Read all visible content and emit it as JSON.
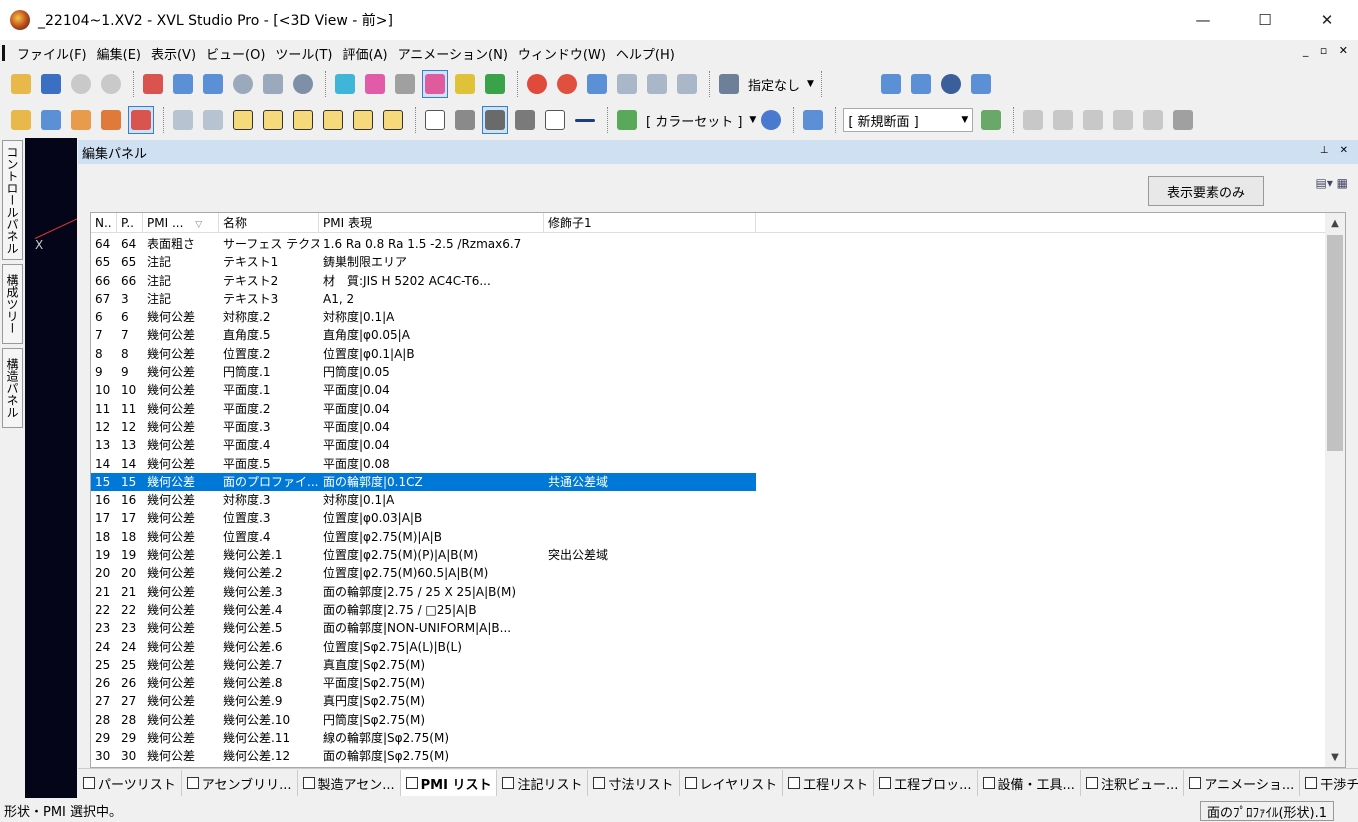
{
  "window": {
    "title": "_22104~1.XV2 - XVL Studio Pro - [<3D View - 前>]",
    "minimize": "—",
    "maximize": "☐",
    "close": "✕"
  },
  "menu": [
    {
      "label": "ファイル(F)"
    },
    {
      "label": "編集(E)"
    },
    {
      "label": "表示(V)"
    },
    {
      "label": "ビュー(O)"
    },
    {
      "label": "ツール(T)"
    },
    {
      "label": "評価(A)"
    },
    {
      "label": "アニメーション(N)"
    },
    {
      "label": "ウィンドウ(W)"
    },
    {
      "label": "ヘルプ(H)"
    }
  ],
  "mdi_controls": "_ ▫ ✕",
  "toolbar": {
    "display_mode": "指定なし",
    "color_set": "[ カラーセット ]",
    "section": "[ 新規断面 ]"
  },
  "left_tabs": [
    {
      "label": "コントロールパネル"
    },
    {
      "label": "構成ツリー"
    },
    {
      "label": "構造パネル"
    }
  ],
  "view3d": {
    "axis_label": "X"
  },
  "panel": {
    "title": "編集パネル",
    "pin": "⊥ ✕",
    "show_only_button": "表示要素のみ"
  },
  "list": {
    "columns": [
      "N..",
      "P..",
      "PMI ...",
      "名称",
      "PMI 表現",
      "修飾子1"
    ],
    "sort_indicator": "▽",
    "rows": [
      {
        "n": "64",
        "p": "64",
        "type": "表面粗さ",
        "name": "サーフェス テクス...",
        "expr": "1.6 Ra 0.8 Ra 1.5 -2.5 /Rzmax6.7",
        "mod": ""
      },
      {
        "n": "65",
        "p": "65",
        "type": "注記",
        "name": "テキスト1",
        "expr": "鋳巣制限エリア",
        "mod": ""
      },
      {
        "n": "66",
        "p": "66",
        "type": "注記",
        "name": "テキスト2",
        "expr": "材　質:JIS H 5202 AC4C-T6...",
        "mod": ""
      },
      {
        "n": "67",
        "p": "3",
        "type": "注記",
        "name": "テキスト3",
        "expr": " A1, 2",
        "mod": ""
      },
      {
        "n": "6",
        "p": "6",
        "type": "幾何公差",
        "name": "対称度.2",
        "expr": "対称度|0.1|A",
        "mod": ""
      },
      {
        "n": "7",
        "p": "7",
        "type": "幾何公差",
        "name": "直角度.5",
        "expr": "直角度|φ0.05|A",
        "mod": ""
      },
      {
        "n": "8",
        "p": "8",
        "type": "幾何公差",
        "name": "位置度.2",
        "expr": "位置度|φ0.1|A|B",
        "mod": ""
      },
      {
        "n": "9",
        "p": "9",
        "type": "幾何公差",
        "name": "円筒度.1",
        "expr": "円筒度|0.05",
        "mod": ""
      },
      {
        "n": "10",
        "p": "10",
        "type": "幾何公差",
        "name": "平面度.1",
        "expr": "平面度|0.04",
        "mod": ""
      },
      {
        "n": "11",
        "p": "11",
        "type": "幾何公差",
        "name": "平面度.2",
        "expr": "平面度|0.04",
        "mod": ""
      },
      {
        "n": "12",
        "p": "12",
        "type": "幾何公差",
        "name": "平面度.3",
        "expr": "平面度|0.04",
        "mod": ""
      },
      {
        "n": "13",
        "p": "13",
        "type": "幾何公差",
        "name": "平面度.4",
        "expr": "平面度|0.04",
        "mod": ""
      },
      {
        "n": "14",
        "p": "14",
        "type": "幾何公差",
        "name": "平面度.5",
        "expr": "平面度|0.08",
        "mod": ""
      },
      {
        "n": "15",
        "p": "15",
        "type": "幾何公差",
        "name": "面のプロファイ...",
        "expr": "面の輪郭度|0.1CZ",
        "mod": "共通公差域",
        "selected": true
      },
      {
        "n": "16",
        "p": "16",
        "type": "幾何公差",
        "name": "対称度.3",
        "expr": "対称度|0.1|A",
        "mod": ""
      },
      {
        "n": "17",
        "p": "17",
        "type": "幾何公差",
        "name": "位置度.3",
        "expr": "位置度|φ0.03|A|B",
        "mod": ""
      },
      {
        "n": "18",
        "p": "18",
        "type": "幾何公差",
        "name": "位置度.4",
        "expr": "位置度|φ2.75(M)|A|B",
        "mod": ""
      },
      {
        "n": "19",
        "p": "19",
        "type": "幾何公差",
        "name": "幾何公差.1",
        "expr": "位置度|φ2.75(M)(P)|A|B(M)",
        "mod": "突出公差域"
      },
      {
        "n": "20",
        "p": "20",
        "type": "幾何公差",
        "name": "幾何公差.2",
        "expr": "位置度|φ2.75(M)60.5|A|B(M)",
        "mod": ""
      },
      {
        "n": "21",
        "p": "21",
        "type": "幾何公差",
        "name": "幾何公差.3",
        "expr": "面の輪郭度|2.75 / 25 X 25|A|B(M)",
        "mod": ""
      },
      {
        "n": "22",
        "p": "22",
        "type": "幾何公差",
        "name": "幾何公差.4",
        "expr": "面の輪郭度|2.75 / □25|A|B",
        "mod": ""
      },
      {
        "n": "23",
        "p": "23",
        "type": "幾何公差",
        "name": "幾何公差.5",
        "expr": "面の輪郭度|NON-UNIFORM|A|B...",
        "mod": ""
      },
      {
        "n": "24",
        "p": "24",
        "type": "幾何公差",
        "name": "幾何公差.6",
        "expr": "位置度|Sφ2.75|A(L)|B(L)",
        "mod": ""
      },
      {
        "n": "25",
        "p": "25",
        "type": "幾何公差",
        "name": "幾何公差.7",
        "expr": "真直度|Sφ2.75(M)",
        "mod": ""
      },
      {
        "n": "26",
        "p": "26",
        "type": "幾何公差",
        "name": "幾何公差.8",
        "expr": "平面度|Sφ2.75(M)",
        "mod": ""
      },
      {
        "n": "27",
        "p": "27",
        "type": "幾何公差",
        "name": "幾何公差.9",
        "expr": "真円度|Sφ2.75(M)",
        "mod": ""
      },
      {
        "n": "28",
        "p": "28",
        "type": "幾何公差",
        "name": "幾何公差.10",
        "expr": "円筒度|Sφ2.75(M)",
        "mod": ""
      },
      {
        "n": "29",
        "p": "29",
        "type": "幾何公差",
        "name": "幾何公差.11",
        "expr": "線の輪郭度|Sφ2.75(M)",
        "mod": ""
      },
      {
        "n": "30",
        "p": "30",
        "type": "幾何公差",
        "name": "幾何公差.12",
        "expr": "面の輪郭度|Sφ2.75(M)",
        "mod": ""
      }
    ]
  },
  "bottom_tabs": [
    {
      "label": "パーツリスト"
    },
    {
      "label": "アセンブリリ..."
    },
    {
      "label": "製造アセン..."
    },
    {
      "label": "PMI リスト",
      "active": true
    },
    {
      "label": "注記リスト"
    },
    {
      "label": "寸法リスト"
    },
    {
      "label": "レイヤリスト"
    },
    {
      "label": "工程リスト"
    },
    {
      "label": "工程ブロッ..."
    },
    {
      "label": "設備・工具..."
    },
    {
      "label": "注釈ビュー..."
    },
    {
      "label": "アニメーショ..."
    },
    {
      "label": "干渉チェッ..."
    }
  ],
  "status": {
    "left": "形状・PMI 選択中。",
    "right": "面のﾌﾟﾛﾌｧｲﾙ(形状).1"
  },
  "colors": {
    "selection": "#0078d7",
    "panel_header": "#cfe0f3",
    "view_background": "#05051a"
  }
}
